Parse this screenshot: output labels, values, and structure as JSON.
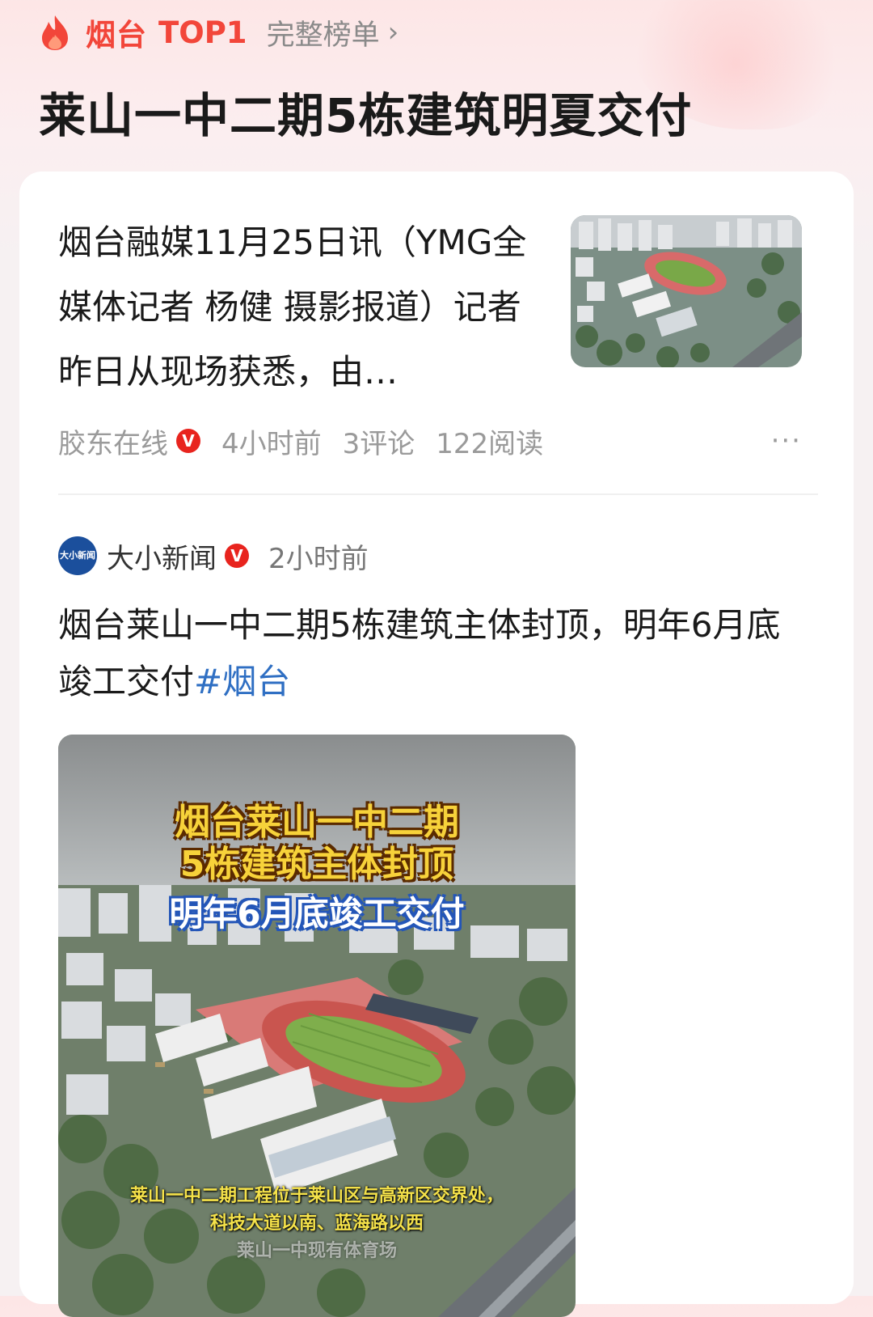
{
  "header": {
    "city": "烟台",
    "rank_label": "TOP1",
    "full_list_link": "完整榜单",
    "title": "莱山一中二期5栋建筑明夏交付"
  },
  "article1": {
    "summary": "烟台融媒11月25日讯（YMG全媒体记者 杨健 摄影报道）记者昨日从现场获悉，由…",
    "source": "胶东在线",
    "verified_badge": "V",
    "time": "4小时前",
    "comments": "3评论",
    "reads": "122阅读",
    "more_icon": "more-dots-icon"
  },
  "article2": {
    "source": "大小新闻",
    "logo_text": "大小新闻",
    "verified_badge": "V",
    "time": "2小时前",
    "title": "烟台莱山一中二期5栋建筑主体封顶，明年6月底竣工交付",
    "hashtag": "#烟台",
    "video": {
      "title_line1": "烟台莱山一中二期",
      "title_line2": "5栋建筑主体封顶",
      "title_line3": "明年6月底竣工交付",
      "caption_line1": "莱山一中二期工程位于莱山区与高新区交界处，",
      "caption_line2": "科技大道以南、蓝海路以西",
      "caption_line3": "莱山一中现有体育场"
    }
  },
  "colors": {
    "accent_red": "#f2463a",
    "hashtag_blue": "#2f6fc3",
    "badge_red": "#e8241e"
  }
}
